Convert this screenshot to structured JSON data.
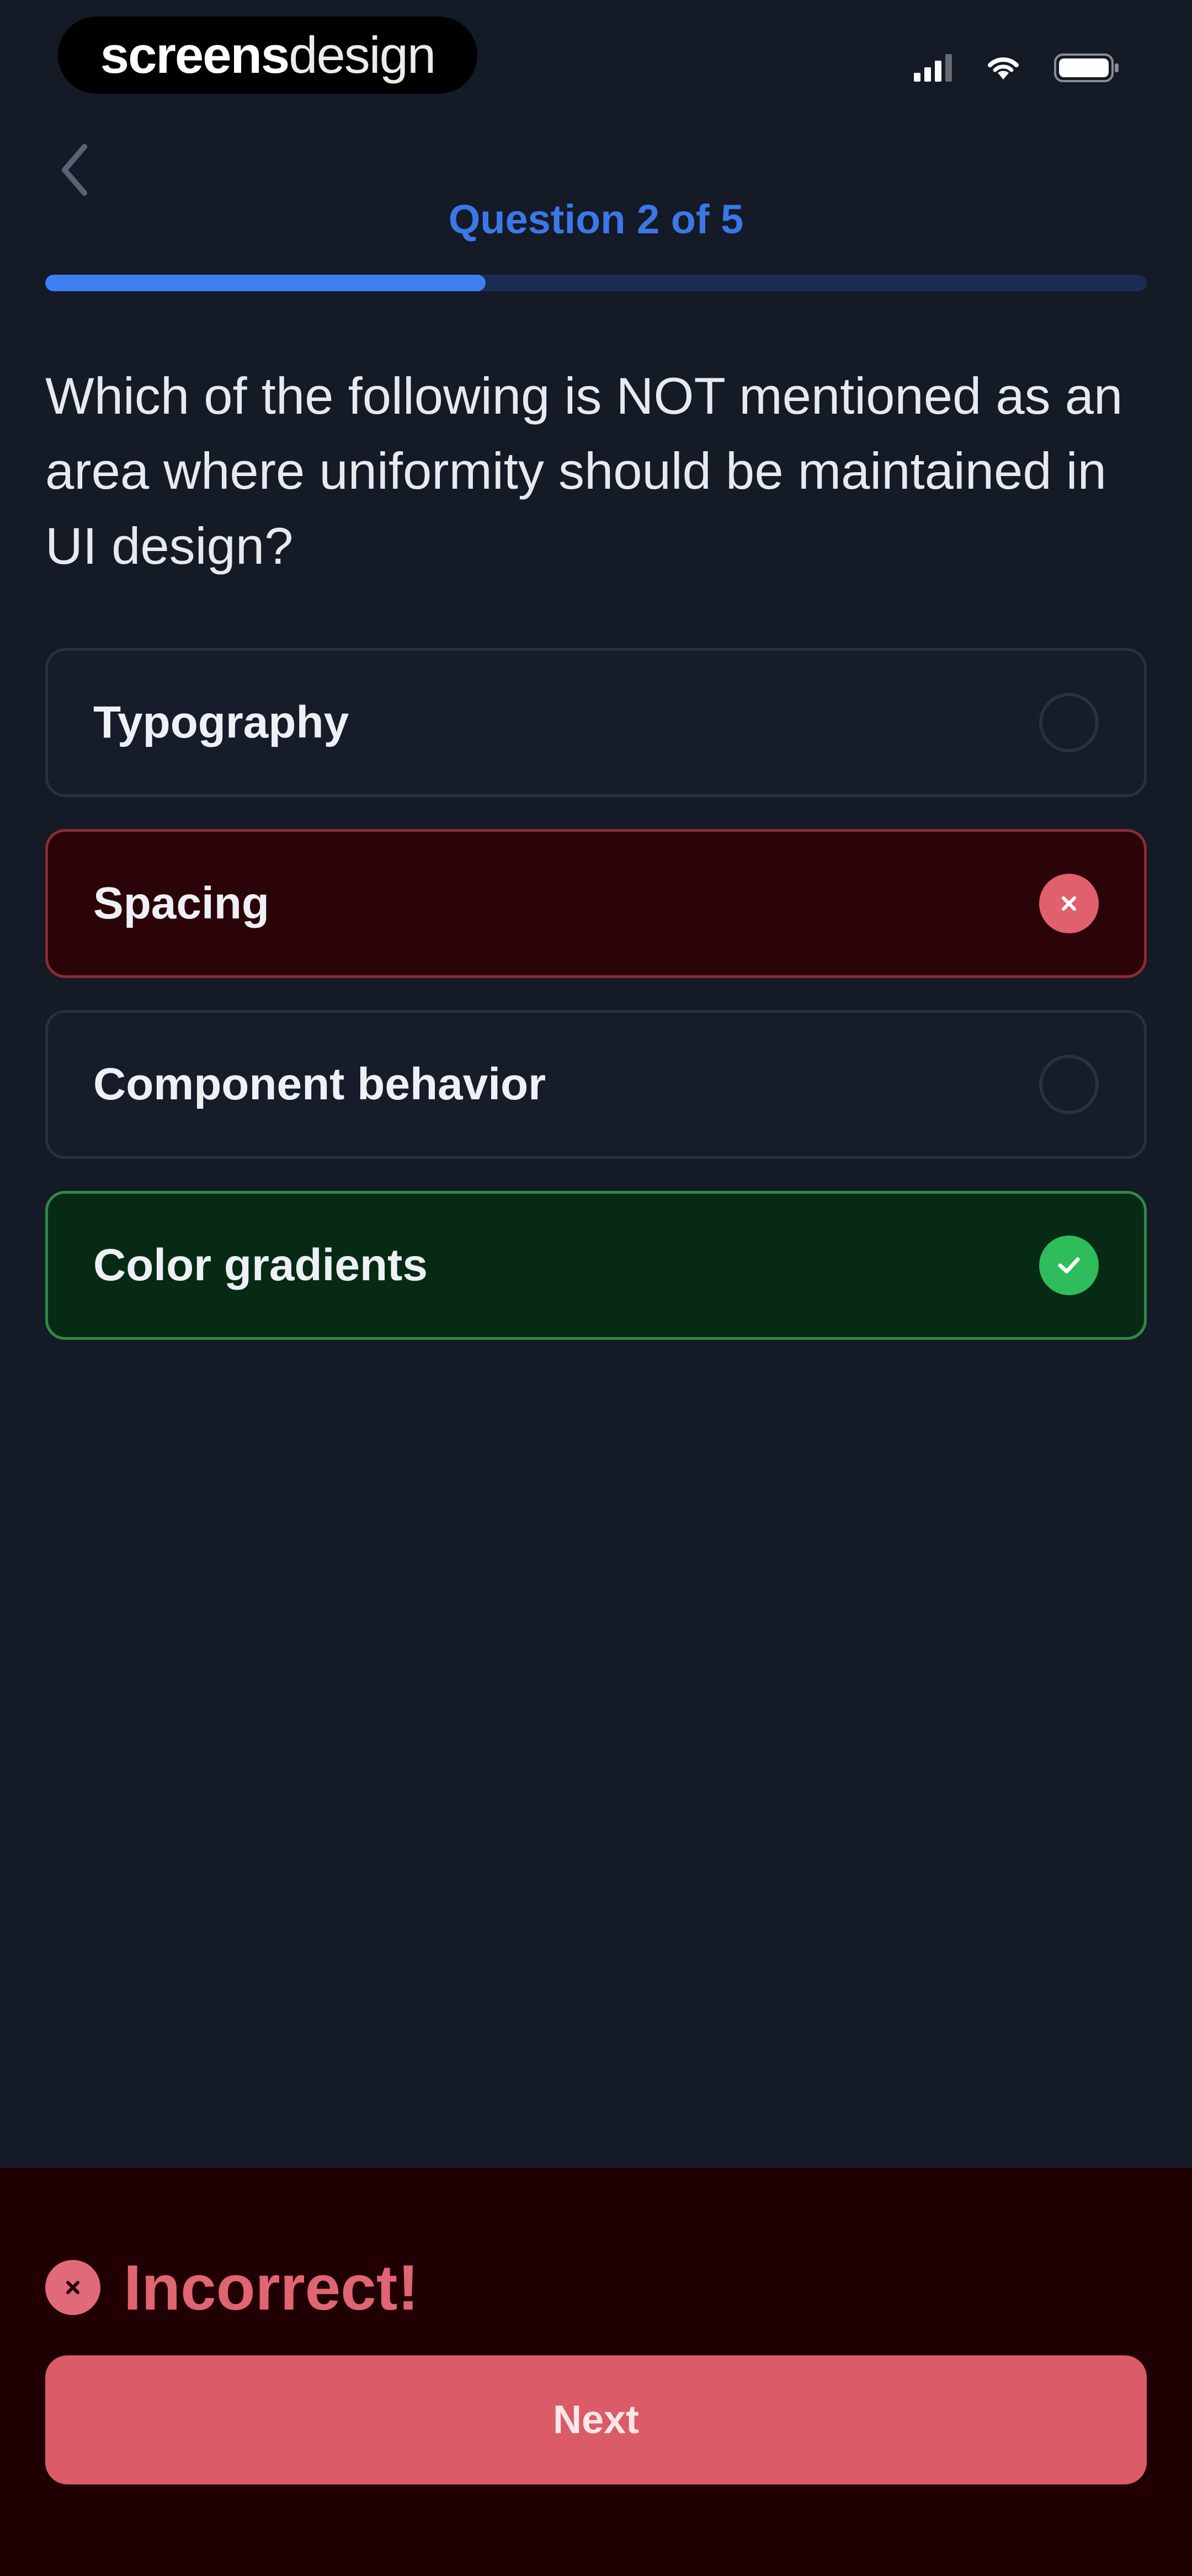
{
  "status_bar": {
    "brand_bold": "screens",
    "brand_light": "design",
    "icons": [
      "signal-icon",
      "wifi-icon",
      "battery-icon"
    ]
  },
  "nav": {
    "back_icon": "chevron-left-icon",
    "question_counter": "Question 2 of 5",
    "progress_fraction": 0.4
  },
  "question": {
    "text": "Which of the following is NOT mentioned as an area where uniformity should be maintained in UI design?"
  },
  "options": [
    {
      "label": "Typography",
      "state": "default"
    },
    {
      "label": "Spacing",
      "state": "wrong"
    },
    {
      "label": "Component behavior",
      "state": "default"
    },
    {
      "label": "Color gradients",
      "state": "correct"
    }
  ],
  "feedback": {
    "icon": "x-circle-icon",
    "text": "Incorrect!",
    "next_label": "Next"
  },
  "colors": {
    "background": "#141a26",
    "accent": "#3d7ef0",
    "wrong": "#e0606e",
    "correct": "#2ebd5a",
    "feedback_bg": "#200003"
  }
}
